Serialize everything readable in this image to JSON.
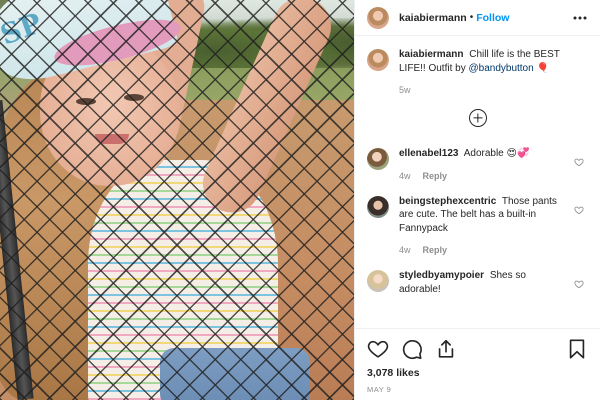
{
  "post": {
    "owner": {
      "username": "kaiabiermann",
      "follow_label": "Follow",
      "separator": "•"
    },
    "photo": {
      "cap_text": "SP"
    },
    "caption": {
      "username": "kaiabiermann",
      "text": "Chill life is the BEST LIFE!! Outfit by",
      "mention": "@bandybutton",
      "emoji": "🎈",
      "age": "5w"
    },
    "comments": [
      {
        "username": "ellenabel123",
        "text": "Adorable 😍💞",
        "age": "4w",
        "reply_label": "Reply"
      },
      {
        "username": "beingstephexcentric",
        "text": "Those pants are cute. The belt has a built-in Fannypack",
        "age": "4w",
        "reply_label": "Reply"
      },
      {
        "username": "styledbyamypoier",
        "text": "Shes so adorable!",
        "age": "",
        "reply_label": ""
      }
    ],
    "likes": "3,078 likes",
    "date": "MAY 9"
  },
  "icons": {
    "more": "more-options-icon",
    "load_more": "add-circle-icon",
    "like": "heart-outline-icon",
    "comment": "comment-bubble-icon",
    "share": "share-icon",
    "save": "bookmark-icon",
    "comment_like": "small-heart-icon"
  },
  "colors": {
    "accent": "#0095f6",
    "mention": "#00376b",
    "muted": "#8e8e8e",
    "text": "#262626"
  }
}
